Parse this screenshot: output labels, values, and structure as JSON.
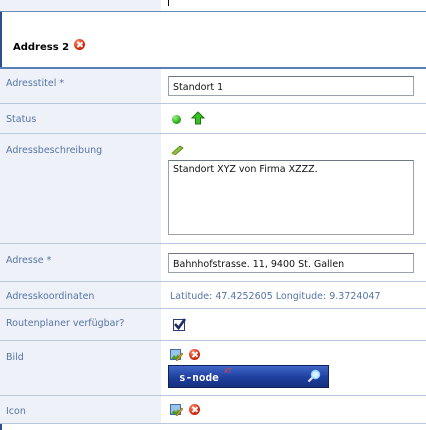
{
  "section": {
    "title": "Address 2"
  },
  "rows": {
    "adresstitel": {
      "label": "Adresstitel *",
      "value": "Standort 1"
    },
    "status": {
      "label": "Status"
    },
    "adressbeschreibung": {
      "label": "Adressbeschreibung",
      "value": "Standort XYZ von Firma XZZZ."
    },
    "adresse": {
      "label": "Adresse *",
      "value": "Bahnhofstrasse. 11, 9400 St. Gallen"
    },
    "adresskoordinaten": {
      "label": "Adresskoordinaten",
      "value": "Latitude: 47.4252605 Longitude: 9.3724047"
    },
    "routenplaner": {
      "label": "Routenplaner verfügbar?",
      "checked": true
    },
    "bild": {
      "label": "Bild",
      "logo_text": "s-node",
      "logo_sup": "XT"
    },
    "icon": {
      "label": "Icon"
    }
  },
  "icons": {
    "delete": "delete-icon",
    "status_dot": "green-dot-icon",
    "status_arrow": "arrow-up-icon",
    "pencil": "pencil-icon",
    "edit": "edit-image-icon",
    "zoom": "magnifier-icon"
  },
  "colors": {
    "label_bg": "#eef2f8",
    "label_text": "#5674a6",
    "accent": "#2d4f8c"
  }
}
